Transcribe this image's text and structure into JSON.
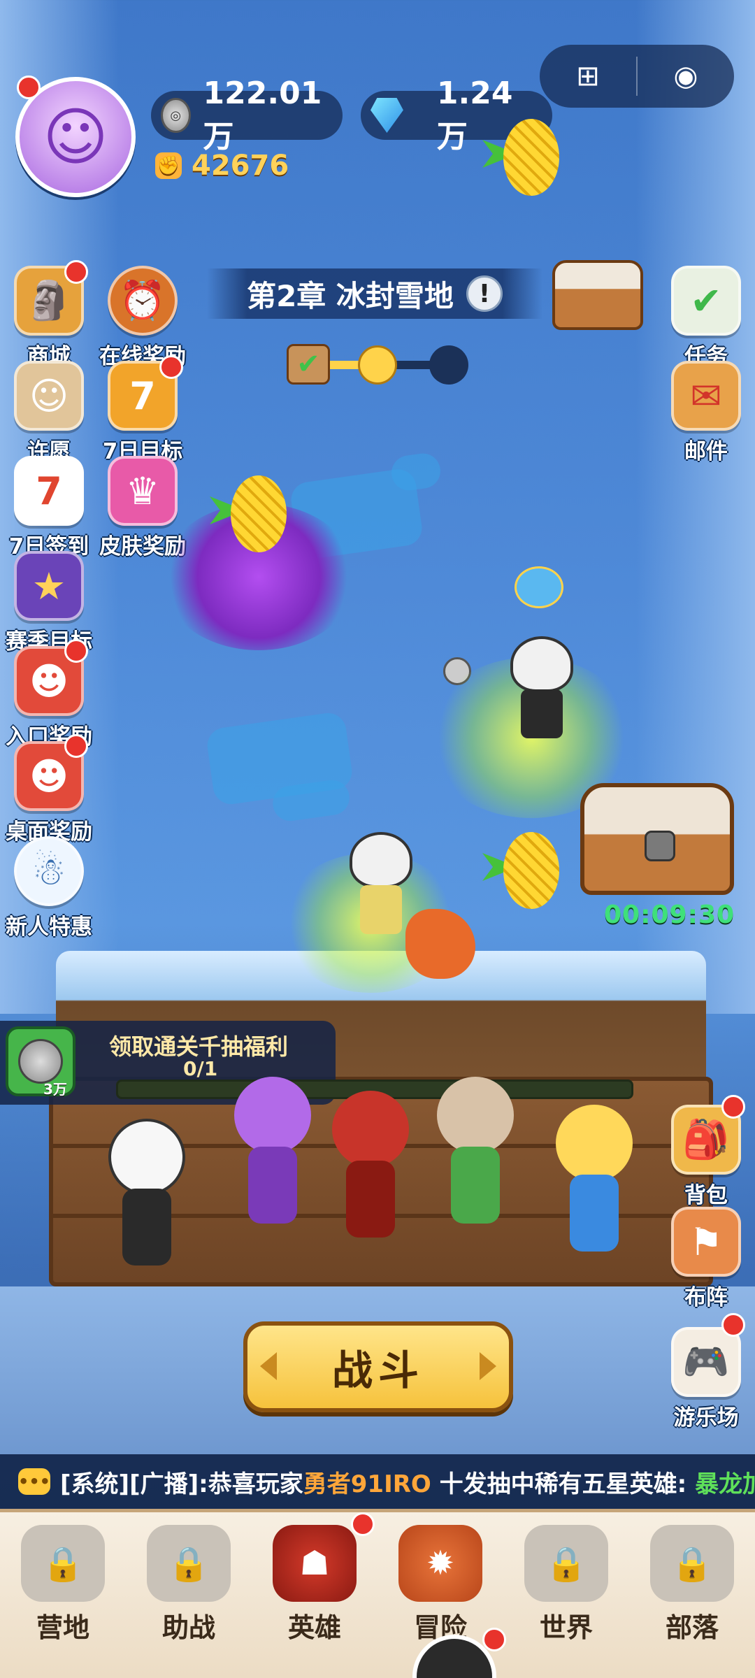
{
  "currency": {
    "coins": "122.01万",
    "gems": "1.24万",
    "power": "42676"
  },
  "chapter": {
    "title": "第2章 冰封雪地"
  },
  "chapter_progress": {
    "fraction": 0.5
  },
  "left_menu": [
    {
      "name": "shop",
      "label": "商城",
      "icon": "totem-icon",
      "badge": true
    },
    {
      "name": "online-reward",
      "label": "在线奖励",
      "icon": "clock-icon",
      "badge": false
    },
    {
      "name": "wish",
      "label": "许愿",
      "icon": "statue-icon",
      "badge": false
    },
    {
      "name": "seven-day-goal",
      "label": "7日目标",
      "icon": "seven-icon",
      "badge": true
    },
    {
      "name": "seven-day-signin",
      "label": "7日签到",
      "icon": "calendar-icon",
      "badge": false
    },
    {
      "name": "skin-reward",
      "label": "皮肤奖励",
      "icon": "skin-icon",
      "badge": false
    },
    {
      "name": "season-goal",
      "label": "赛季目标",
      "icon": "badge-icon",
      "badge": false
    },
    {
      "name": "entry-reward",
      "label": "入口奖励",
      "icon": "panda-icon",
      "badge": true
    },
    {
      "name": "desktop-reward",
      "label": "桌面奖励",
      "icon": "panda-arrow-icon",
      "badge": true
    },
    {
      "name": "newbie-offer",
      "label": "新人特惠",
      "icon": "snowman-icon",
      "badge": false
    }
  ],
  "right_menu_top": [
    {
      "name": "tasks",
      "label": "任务",
      "icon": "checklist-icon"
    },
    {
      "name": "mail",
      "label": "邮件",
      "icon": "envelope-icon"
    }
  ],
  "right_menu_bottom": [
    {
      "name": "backpack",
      "label": "背包",
      "icon": "backpack-icon",
      "badge": true
    },
    {
      "name": "formation",
      "label": "布阵",
      "icon": "formation-icon",
      "badge": false
    },
    {
      "name": "playground",
      "label": "游乐场",
      "icon": "gamepad-icon",
      "badge": true
    }
  ],
  "chest": {
    "timer": "00:09:30"
  },
  "reward": {
    "title": "领取通关千抽福利",
    "progress_text": "0/1",
    "item_qty": "3万",
    "fraction": 0
  },
  "fight_button": {
    "label": "战斗"
  },
  "broadcast": {
    "prefix": "[系统][广播]:恭喜玩家",
    "player": "勇者91IRO",
    "middle": " 十发抽中稀有五星英雄: ",
    "hero": "暴龙加"
  },
  "bottom_nav": [
    {
      "name": "camp",
      "label": "营地",
      "icon": "lock-icon",
      "locked": true,
      "badge": false
    },
    {
      "name": "assist",
      "label": "助战",
      "icon": "lock-icon",
      "locked": true,
      "badge": false
    },
    {
      "name": "heroes",
      "label": "英雄",
      "icon": "mask-icon",
      "locked": false,
      "badge": true
    },
    {
      "name": "adventure",
      "label": "冒险",
      "icon": "spiked-shell-icon",
      "locked": false,
      "badge": false
    },
    {
      "name": "world",
      "label": "世界",
      "icon": "lock-icon",
      "locked": true,
      "badge": false
    },
    {
      "name": "tribe",
      "label": "部落",
      "icon": "lock-icon",
      "locked": true,
      "badge": false
    }
  ],
  "colors": {
    "accent_gold": "#ffd25a",
    "broadcast_player": "#ffa63a",
    "broadcast_hero": "#5fe05a",
    "timer_green": "#3fe07a",
    "badge_red": "#e8332c"
  }
}
